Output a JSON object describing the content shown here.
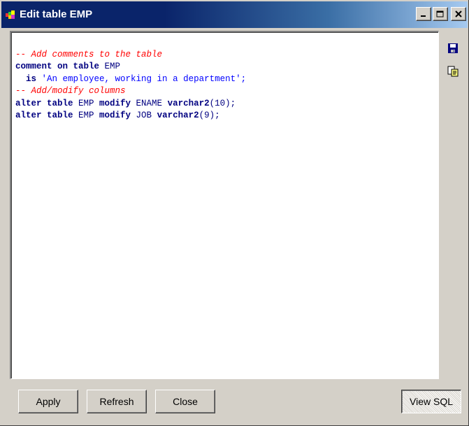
{
  "window": {
    "title": "Edit table EMP",
    "controls": {
      "minimize": "_",
      "maximize": "□",
      "close": "×"
    }
  },
  "editor": {
    "line1": {
      "comment": "-- Add comments to the table"
    },
    "line2": {
      "kw1": "comment on table",
      "name": " EMP"
    },
    "line3": {
      "indent": "  ",
      "kw": "is",
      "str": " 'An employee, working in a department';"
    },
    "line4": {
      "comment": "-- Add/modify columns"
    },
    "line5": {
      "kw1": "alter table",
      "name1": " EMP ",
      "kw2": "modify",
      "name2": " ENAME ",
      "kw3": "varchar2",
      "rest": "(10);"
    },
    "line6": {
      "kw1": "alter table",
      "name1": " EMP ",
      "kw2": "modify",
      "name2": " JOB ",
      "kw3": "varchar2",
      "rest": "(9);"
    }
  },
  "side_icons": [
    "save-icon",
    "copy-icon"
  ],
  "buttons": {
    "apply": "Apply",
    "refresh": "Refresh",
    "close": "Close",
    "view_sql": "View SQL"
  },
  "colors": {
    "titlebar_start": "#0a246a",
    "titlebar_end": "#a6caf0",
    "comment": "#ff0000",
    "keyword": "#000080",
    "string": "#0000ff",
    "face": "#d4d0c8"
  }
}
